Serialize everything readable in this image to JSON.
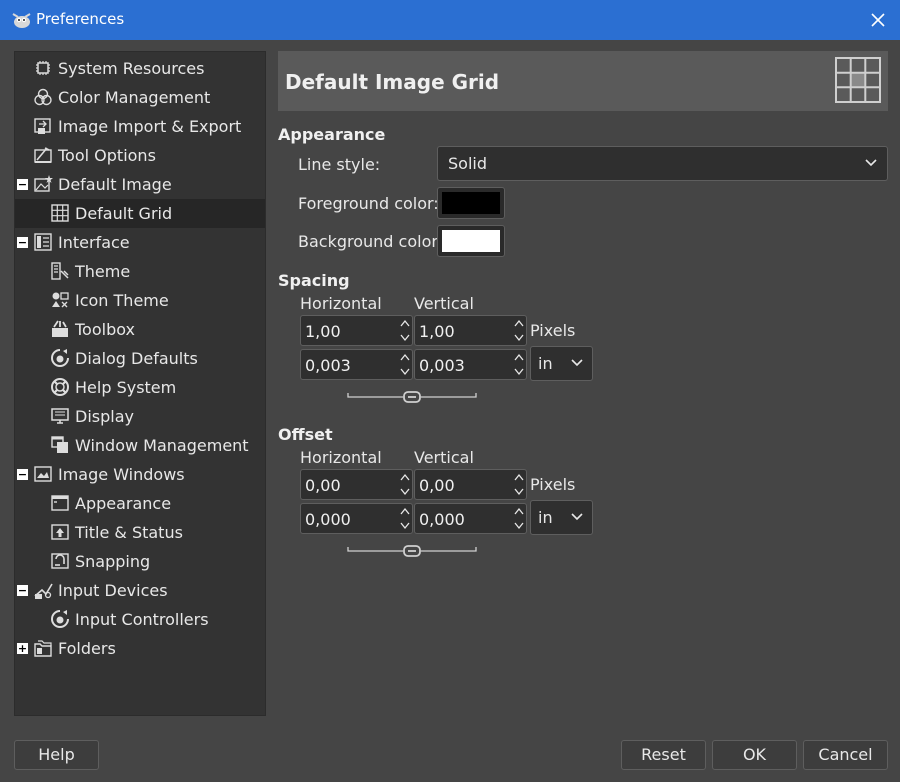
{
  "window": {
    "title": "Preferences",
    "app_icon": "gimp-wilber-icon",
    "close_icon": "close-icon"
  },
  "sidebar": {
    "items": [
      {
        "label": "System Resources",
        "icon": "chip-icon",
        "expander": ""
      },
      {
        "label": "Color Management",
        "icon": "color-circles-icon",
        "expander": ""
      },
      {
        "label": "Image Import & Export",
        "icon": "import-export-icon",
        "expander": ""
      },
      {
        "label": "Tool Options",
        "icon": "tool-options-icon",
        "expander": ""
      },
      {
        "label": "Default Image",
        "icon": "default-image-icon",
        "expander": "−"
      },
      {
        "label": "Default Grid",
        "icon": "grid-icon",
        "expander": ""
      },
      {
        "label": "Interface",
        "icon": "interface-icon",
        "expander": "−"
      },
      {
        "label": "Theme",
        "icon": "theme-icon",
        "expander": ""
      },
      {
        "label": "Icon Theme",
        "icon": "icon-theme-icon",
        "expander": ""
      },
      {
        "label": "Toolbox",
        "icon": "toolbox-icon",
        "expander": ""
      },
      {
        "label": "Dialog Defaults",
        "icon": "dialog-defaults-icon",
        "expander": ""
      },
      {
        "label": "Help System",
        "icon": "help-lifebuoy-icon",
        "expander": ""
      },
      {
        "label": "Display",
        "icon": "display-icon",
        "expander": ""
      },
      {
        "label": "Window Management",
        "icon": "window-management-icon",
        "expander": ""
      },
      {
        "label": "Image Windows",
        "icon": "image-windows-icon",
        "expander": "−"
      },
      {
        "label": "Appearance",
        "icon": "appearance-icon",
        "expander": ""
      },
      {
        "label": "Title & Status",
        "icon": "title-status-icon",
        "expander": ""
      },
      {
        "label": "Snapping",
        "icon": "snapping-icon",
        "expander": ""
      },
      {
        "label": "Input Devices",
        "icon": "input-devices-icon",
        "expander": "−"
      },
      {
        "label": "Input Controllers",
        "icon": "input-controllers-icon",
        "expander": ""
      },
      {
        "label": "Folders",
        "icon": "folders-icon",
        "expander": "+"
      }
    ],
    "selected": "Default Grid"
  },
  "header": {
    "title": "Default Image Grid",
    "icon": "grid-large-icon"
  },
  "appearance": {
    "title": "Appearance",
    "line_style_label": "Line style:",
    "line_style_value": "Solid",
    "fg_label": "Foreground color:",
    "fg_color": "#000000",
    "bg_label": "Background color:",
    "bg_color": "#ffffff"
  },
  "spacing": {
    "title": "Spacing",
    "h_label": "Horizontal",
    "v_label": "Vertical",
    "h_pixels": "1,00",
    "v_pixels": "1,00",
    "pixels_unit": "Pixels",
    "h_inches": "0,003",
    "v_inches": "0,003",
    "unit_value": "in"
  },
  "offset": {
    "title": "Offset",
    "h_label": "Horizontal",
    "v_label": "Vertical",
    "h_pixels": "0,00",
    "v_pixels": "0,00",
    "pixels_unit": "Pixels",
    "h_inches": "0,000",
    "v_inches": "0,000",
    "unit_value": "in"
  },
  "buttons": {
    "help": "Help",
    "reset": "Reset",
    "ok": "OK",
    "cancel": "Cancel"
  },
  "colors": {
    "titlebar": "#2b6fd2",
    "background": "#454545",
    "sidebar": "#333333",
    "selected_row": "#262626"
  }
}
